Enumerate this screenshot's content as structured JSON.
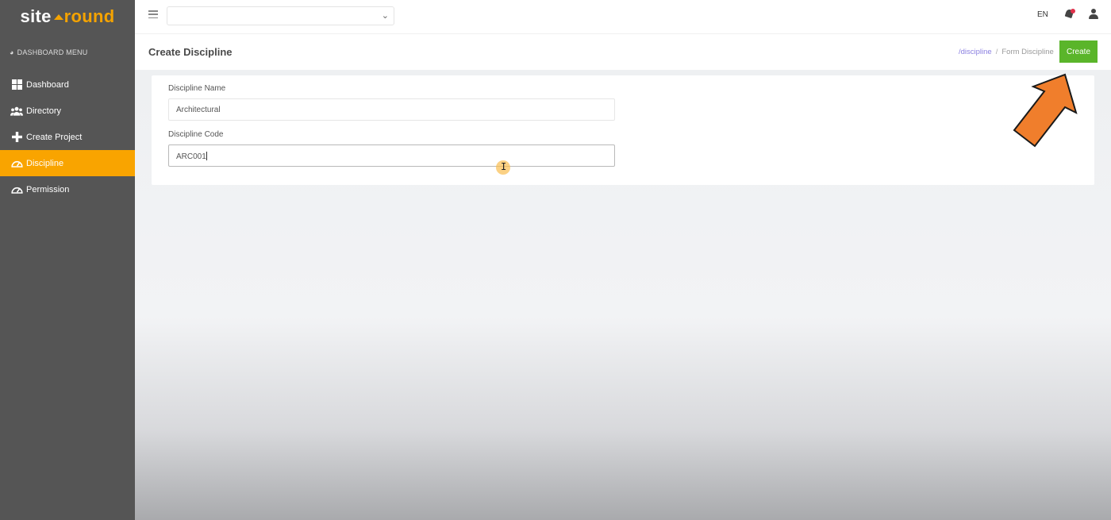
{
  "app": {
    "logo_part1": "site",
    "logo_part2": "round"
  },
  "sidebar": {
    "menu_header": "DASHBOARD MENU",
    "menu_header_icon": "dashboard-gauge-icon",
    "items": [
      {
        "label": "Dashboard",
        "icon": "grid-icon",
        "active": false
      },
      {
        "label": "Directory",
        "icon": "users-icon",
        "active": false
      },
      {
        "label": "Create Project",
        "icon": "plus-icon",
        "active": false
      },
      {
        "label": "Discipline",
        "icon": "gauge-icon",
        "active": true
      },
      {
        "label": "Permission",
        "icon": "gauge-icon",
        "active": false
      }
    ]
  },
  "topbar": {
    "project_select_value": "",
    "language": "EN",
    "icons": [
      "hamburger-icon",
      "bell-icon",
      "user-icon"
    ]
  },
  "header": {
    "title": "Create Discipline",
    "breadcrumb": {
      "link": "/discipline",
      "separator": "/",
      "current": "Form Discipline"
    },
    "create_label": "Create"
  },
  "form": {
    "name_label": "Discipline Name",
    "name_value": "Architectural",
    "code_label": "Discipline Code",
    "code_value": "ARC001"
  },
  "colors": {
    "sidebar_bg": "#555555",
    "accent": "#f9a400",
    "create_button": "#5ab52a",
    "link": "#8a7fe0",
    "annotation_arrow": "#f07e2c"
  }
}
